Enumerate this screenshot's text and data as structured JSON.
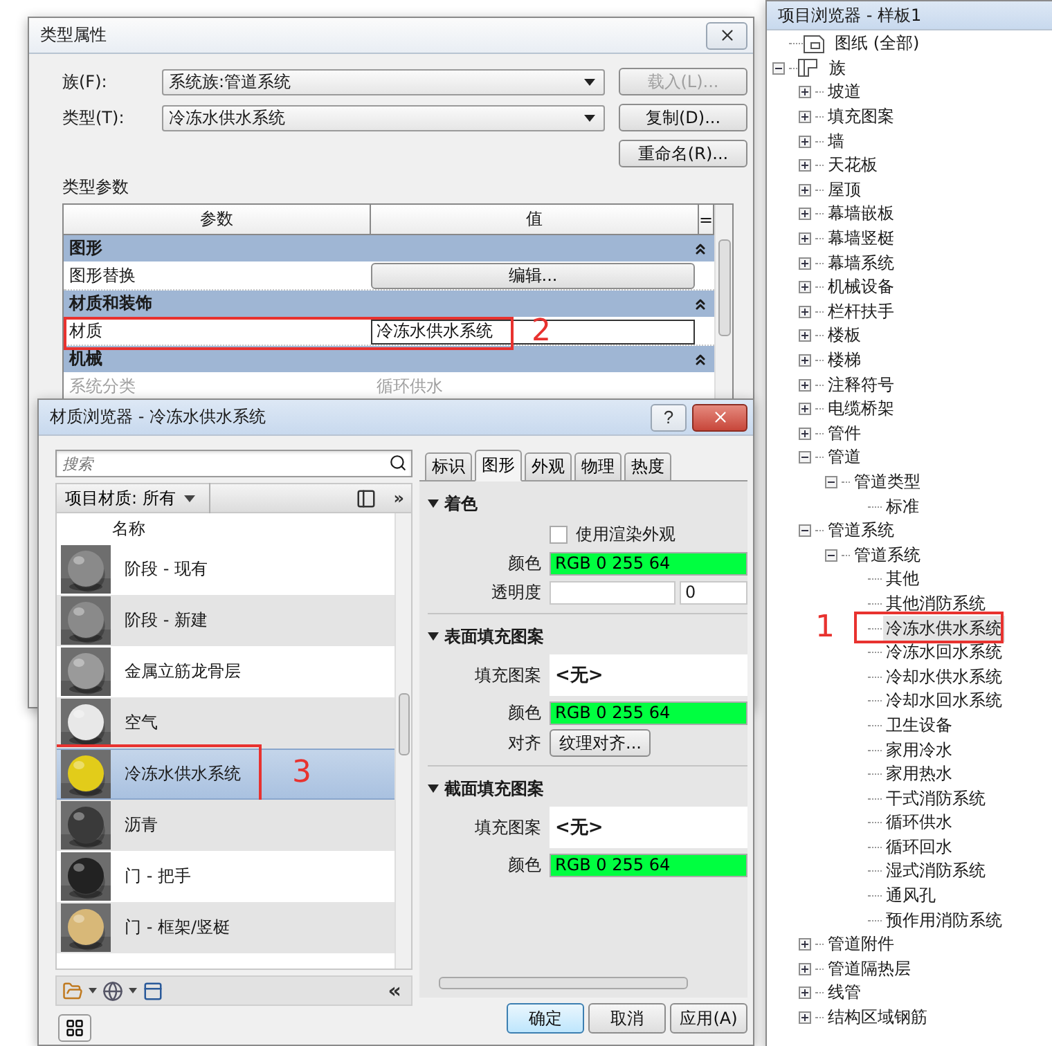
{
  "type_properties": {
    "title": "类型属性",
    "fields": [
      {
        "label": "族(F):",
        "value": "系统族:管道系统",
        "button": "载入(L)...",
        "disabled": true
      },
      {
        "label": "类型(T):",
        "value": "冷冻水供水系统",
        "button": "复制(D)...",
        "disabled": false
      }
    ],
    "extra_button": "重命名(R)...",
    "section_label": "类型参数",
    "columns": [
      "参数",
      "值",
      "="
    ],
    "rows": [
      {
        "kind": "group",
        "label": "图形"
      },
      {
        "kind": "button",
        "parameter": "图形替换",
        "value": "编辑...",
        "disabled": false
      },
      {
        "kind": "group",
        "label": "材质和装饰"
      },
      {
        "kind": "field",
        "parameter": "材质",
        "value": "冷冻水供水系统",
        "disabled": false,
        "callout": "2"
      },
      {
        "kind": "group",
        "label": "机械"
      },
      {
        "kind": "text",
        "parameter": "系统分类",
        "value": "循环供水",
        "disabled": true
      }
    ]
  },
  "material_browser": {
    "title": "材质浏览器 - 冷冻水供水系统",
    "help": "?",
    "search_placeholder": "搜索",
    "library": "项目材质: 所有",
    "more": "»",
    "collapse": "«",
    "column": "名称",
    "materials": [
      {
        "name": "阶段 - 现有",
        "color": "#8a8a8a",
        "selected": false
      },
      {
        "name": "阶段 - 新建",
        "color": "#8a8a8a",
        "selected": false
      },
      {
        "name": "金属立筋龙骨层",
        "color": "#9a9a9a",
        "selected": false
      },
      {
        "name": "空气",
        "color": "#e8e8e8",
        "selected": false
      },
      {
        "name": "冷冻水供水系统",
        "color": "#e2cc1a",
        "selected": true,
        "callout": "3"
      },
      {
        "name": "沥青",
        "color": "#3a3a3a",
        "selected": false
      },
      {
        "name": "门 - 把手",
        "color": "#222222",
        "selected": false
      },
      {
        "name": "门 - 框架/竖梃",
        "color": "#d8b878",
        "selected": false
      }
    ],
    "tabs": [
      {
        "label": "标识",
        "selected": false
      },
      {
        "label": "图形",
        "selected": true
      },
      {
        "label": "外观",
        "selected": false
      },
      {
        "label": "物理",
        "selected": false
      },
      {
        "label": "热度",
        "selected": false
      }
    ],
    "sections": [
      {
        "title": "着色",
        "expanded": true,
        "rows": [
          {
            "kind": "checkbox",
            "label": "使用渲染外观",
            "checked": false
          },
          {
            "kind": "color",
            "label": "颜色",
            "value": "RGB 0 255 64",
            "color": "#00ff40"
          },
          {
            "kind": "slider",
            "label": "透明度",
            "value": "0",
            "level": 0
          }
        ]
      },
      {
        "title": "表面填充图案",
        "expanded": true,
        "rows": [
          {
            "kind": "pattern",
            "label": "填充图案",
            "value": "<无>"
          },
          {
            "kind": "color",
            "label": "颜色",
            "value": "RGB 0 255 64",
            "color": "#00ff40"
          },
          {
            "kind": "button",
            "label": "对齐",
            "value": "纹理对齐..."
          }
        ]
      },
      {
        "title": "截面填充图案",
        "expanded": true,
        "rows": [
          {
            "kind": "pattern",
            "label": "填充图案",
            "value": "<无>"
          },
          {
            "kind": "color",
            "label": "颜色",
            "value": "RGB 0 255 64",
            "color": "#00ff40"
          }
        ]
      }
    ],
    "buttons": [
      {
        "label": "确定",
        "default": true
      },
      {
        "label": "取消",
        "default": false
      },
      {
        "label": "应用(A)",
        "default": false
      }
    ]
  },
  "project_browser": {
    "title": "项目浏览器 - 样板1",
    "tree": [
      {
        "label": "图纸 (全部)",
        "kind": "sheets",
        "selected": false
      },
      {
        "label": "族",
        "kind": "families",
        "expanded": true,
        "selected": false,
        "children": [
          {
            "label": "坡道",
            "kind": "folder",
            "expanded": false,
            "selected": false
          },
          {
            "label": "填充图案",
            "kind": "folder",
            "expanded": false,
            "selected": false
          },
          {
            "label": "墙",
            "kind": "folder",
            "expanded": false,
            "selected": false
          },
          {
            "label": "天花板",
            "kind": "folder",
            "expanded": false,
            "selected": false
          },
          {
            "label": "屋顶",
            "kind": "folder",
            "expanded": false,
            "selected": false
          },
          {
            "label": "幕墙嵌板",
            "kind": "folder",
            "expanded": false,
            "selected": false
          },
          {
            "label": "幕墙竖梃",
            "kind": "folder",
            "expanded": false,
            "selected": false
          },
          {
            "label": "幕墙系统",
            "kind": "folder",
            "expanded": false,
            "selected": false
          },
          {
            "label": "机械设备",
            "kind": "folder",
            "expanded": false,
            "selected": false
          },
          {
            "label": "栏杆扶手",
            "kind": "folder",
            "expanded": false,
            "selected": false
          },
          {
            "label": "楼板",
            "kind": "folder",
            "expanded": false,
            "selected": false
          },
          {
            "label": "楼梯",
            "kind": "folder",
            "expanded": false,
            "selected": false
          },
          {
            "label": "注释符号",
            "kind": "folder",
            "expanded": false,
            "selected": false
          },
          {
            "label": "电缆桥架",
            "kind": "folder",
            "expanded": false,
            "selected": false
          },
          {
            "label": "管件",
            "kind": "folder",
            "expanded": false,
            "selected": false
          },
          {
            "label": "管道",
            "kind": "folder",
            "expanded": true,
            "selected": false,
            "children": [
              {
                "label": "管道类型",
                "kind": "folder",
                "expanded": true,
                "selected": false,
                "children": [
                  {
                    "label": "标准",
                    "kind": "leaf",
                    "selected": false
                  }
                ]
              }
            ]
          },
          {
            "label": "管道系统",
            "kind": "folder",
            "expanded": true,
            "selected": false,
            "children": [
              {
                "label": "管道系统",
                "kind": "folder",
                "expanded": true,
                "selected": false,
                "children": [
                  {
                    "label": "其他",
                    "kind": "leaf",
                    "selected": false
                  },
                  {
                    "label": "其他消防系统",
                    "kind": "leaf",
                    "selected": false
                  },
                  {
                    "label": "冷冻水供水系统",
                    "kind": "leaf",
                    "selected": true,
                    "callout": "1"
                  },
                  {
                    "label": "冷冻水回水系统",
                    "kind": "leaf",
                    "selected": false
                  },
                  {
                    "label": "冷却水供水系统",
                    "kind": "leaf",
                    "selected": false
                  },
                  {
                    "label": "冷却水回水系统",
                    "kind": "leaf",
                    "selected": false
                  },
                  {
                    "label": "卫生设备",
                    "kind": "leaf",
                    "selected": false
                  },
                  {
                    "label": "家用冷水",
                    "kind": "leaf",
                    "selected": false
                  },
                  {
                    "label": "家用热水",
                    "kind": "leaf",
                    "selected": false
                  },
                  {
                    "label": "干式消防系统",
                    "kind": "leaf",
                    "selected": false
                  },
                  {
                    "label": "循环供水",
                    "kind": "leaf",
                    "selected": false
                  },
                  {
                    "label": "循环回水",
                    "kind": "leaf",
                    "selected": false
                  },
                  {
                    "label": "湿式消防系统",
                    "kind": "leaf",
                    "selected": false
                  },
                  {
                    "label": "通风孔",
                    "kind": "leaf",
                    "selected": false
                  },
                  {
                    "label": "预作用消防系统",
                    "kind": "leaf",
                    "selected": false
                  }
                ]
              }
            ]
          },
          {
            "label": "管道附件",
            "kind": "folder",
            "expanded": false,
            "selected": false
          },
          {
            "label": "管道隔热层",
            "kind": "folder",
            "expanded": false,
            "selected": false
          },
          {
            "label": "线管",
            "kind": "folder",
            "expanded": false,
            "selected": false
          },
          {
            "label": "结构区域钢筋",
            "kind": "folder",
            "expanded": false,
            "selected": false
          }
        ]
      }
    ]
  }
}
